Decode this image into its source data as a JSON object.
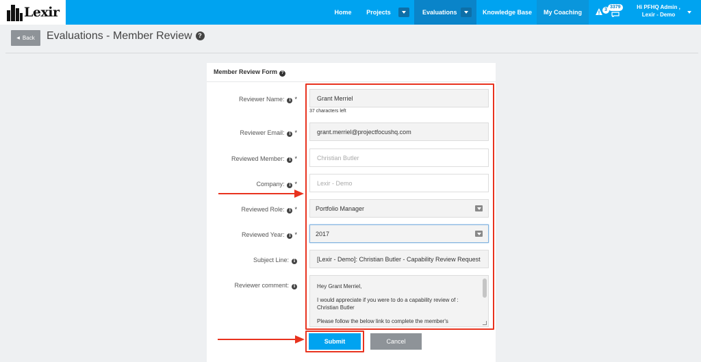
{
  "nav": {
    "logo_text": "Lexir",
    "items": [
      {
        "label": "Home"
      },
      {
        "label": "Projects"
      },
      {
        "label": "Evaluations"
      },
      {
        "label": "Knowledge Base"
      },
      {
        "label": "My Coaching"
      }
    ],
    "alerts_count": "3",
    "messages_count": "3379",
    "greeting": "Hi PFHQ Admin ,",
    "company": "Lexir - Demo"
  },
  "header": {
    "back_label": "Back",
    "title": "Evaluations - Member Review"
  },
  "form": {
    "title": "Member Review Form",
    "characters_left": "37 characters left",
    "fields": [
      {
        "label": "Reviewer Name:",
        "required": "*",
        "value": "Grant Merriel"
      },
      {
        "label": "Reviewer Email:",
        "required": "*",
        "value": "grant.merriel@projectfocushq.com"
      },
      {
        "label": "Reviewed Member:",
        "required": "*",
        "value": "Christian Butler"
      },
      {
        "label": "Company:",
        "required": "*",
        "value": "Lexir - Demo"
      },
      {
        "label": "Reviewed Role:",
        "required": "*",
        "value": "Portfolio Manager"
      },
      {
        "label": "Reviewed Year:",
        "required": "*",
        "value": "2017"
      },
      {
        "label": "Subject Line:",
        "value": "[Lexir - Demo]: Christian Butler - Capability Review Request"
      },
      {
        "label": "Reviewer comment:"
      }
    ],
    "comment_lines": [
      "Hey Grant Merriel,",
      "I would appreciate if you were to do a capability review of : Christian Butler",
      "Please follow the below link to complete the member's"
    ],
    "submit_label": "Submit",
    "cancel_label": "Cancel"
  },
  "colors": {
    "nav_blue": "#00a3f0",
    "nav_active": "#0a84c9",
    "annotation_red": "#e8321e",
    "grey_button": "#8e9398"
  }
}
